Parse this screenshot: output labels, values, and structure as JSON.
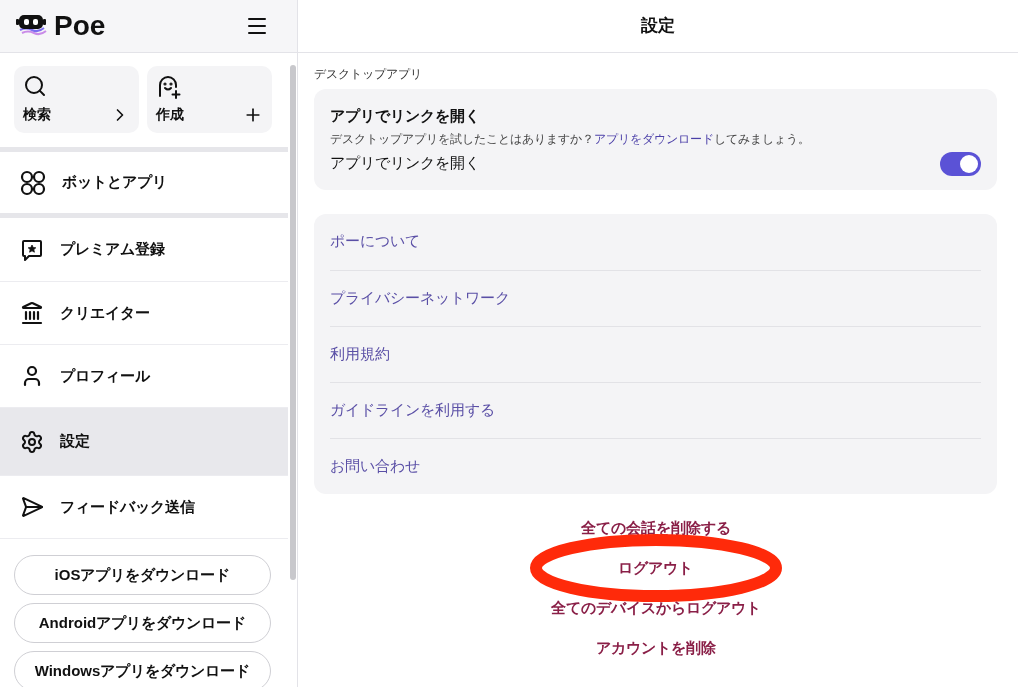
{
  "sidebar": {
    "logo": "Poe",
    "quick_actions": [
      {
        "label": "検索"
      },
      {
        "label": "作成"
      }
    ],
    "nav_groups": [
      [
        {
          "label": "ボットとアプリ",
          "selected": false
        }
      ],
      [
        {
          "label": "プレミアム登録",
          "selected": false
        },
        {
          "label": "クリエイター",
          "selected": false
        },
        {
          "label": "プロフィール",
          "selected": false
        },
        {
          "label": "設定",
          "selected": true
        },
        {
          "label": "フィードバック送信",
          "selected": false
        }
      ]
    ],
    "download_buttons": [
      "iOSアプリをダウンロード",
      "Androidアプリをダウンロード",
      "Windowsアプリをダウンロード"
    ]
  },
  "main": {
    "title": "設定",
    "section_label": "デスクトップアプリ",
    "desktop_card": {
      "title": "アプリでリンクを開く",
      "description": {
        "before": "デスクトップアプリを試したことはありますか？",
        "link": "アプリをダウンロード",
        "after": "してみましょう。"
      },
      "toggle_label": "アプリでリンクを開く",
      "on": true
    },
    "links": [
      "ポーについて",
      "プライバシーネットワーク",
      "利用規約",
      "ガイドラインを利用する",
      "お問い合わせ"
    ],
    "actions": [
      {
        "label": "全ての会話を削除する",
        "highlighted": false
      },
      {
        "label": "ログアウト",
        "highlighted": true
      },
      {
        "label": "全てのデバイスからログアウト",
        "highlighted": false
      },
      {
        "label": "アカウントを削除",
        "highlighted": false
      }
    ]
  }
}
